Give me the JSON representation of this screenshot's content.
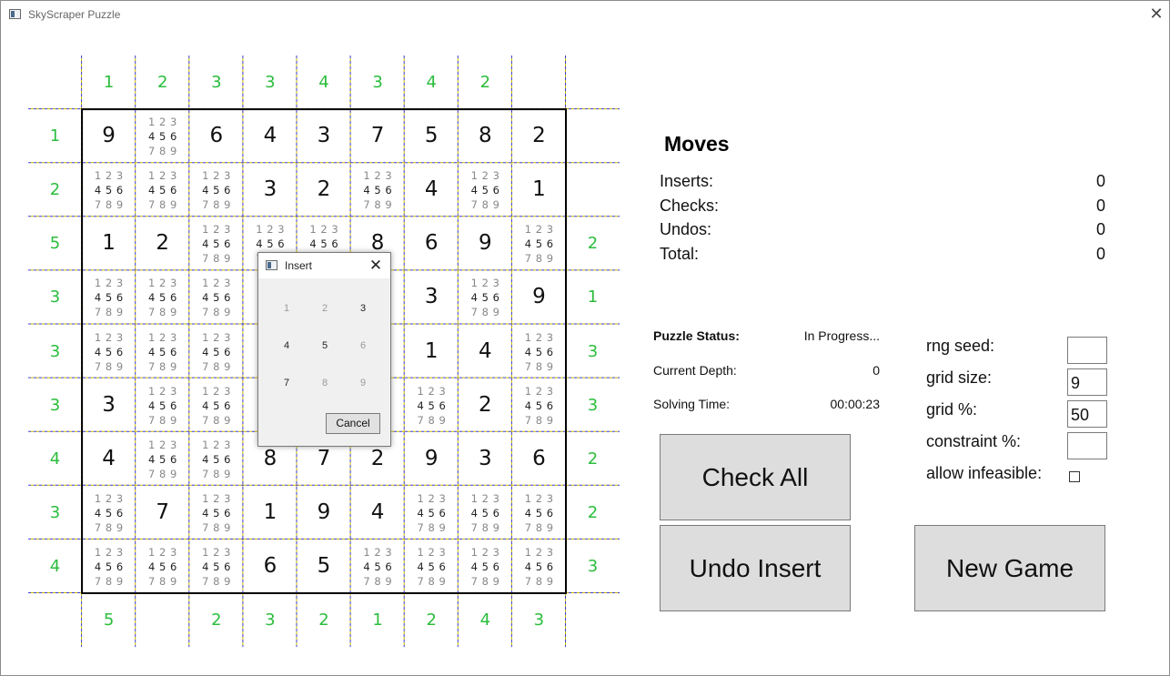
{
  "window": {
    "title": "SkyScraper Puzzle"
  },
  "puzzle": {
    "top_clues": [
      "1",
      "2",
      "3",
      "3",
      "4",
      "3",
      "4",
      "2",
      ""
    ],
    "bottom_clues": [
      "5",
      "",
      "2",
      "3",
      "2",
      "1",
      "2",
      "4",
      "3"
    ],
    "left_clues": [
      "1",
      "2",
      "5",
      "3",
      "3",
      "3",
      "4",
      "3",
      "4"
    ],
    "right_clues": [
      "",
      "",
      "2",
      "1",
      "3",
      "3",
      "2",
      "2",
      "3"
    ],
    "rows": [
      [
        "9",
        "N",
        "6",
        "4",
        "3",
        "7",
        "5",
        "8",
        "2"
      ],
      [
        "N",
        "N",
        "N",
        "3",
        "2",
        "N",
        "4",
        "N",
        "1"
      ],
      [
        "1",
        "2",
        "N",
        "N",
        "N",
        "8",
        "6",
        "9",
        "N"
      ],
      [
        "N",
        "N",
        "N",
        "",
        "",
        "",
        "3",
        "N",
        "9"
      ],
      [
        "N",
        "N",
        "N",
        "",
        "",
        "",
        "1",
        "4",
        "N"
      ],
      [
        "3",
        "N",
        "N",
        "",
        "",
        "",
        "N",
        "2",
        "N"
      ],
      [
        "4",
        "N",
        "N",
        "8",
        "7",
        "2",
        "9",
        "3",
        "6"
      ],
      [
        "N",
        "7",
        "N",
        "1",
        "9",
        "4",
        "N",
        "N",
        "N"
      ],
      [
        "N",
        "N",
        "N",
        "6",
        "5",
        "N",
        "N",
        "N",
        "N"
      ]
    ],
    "note_digits": [
      "1",
      "2",
      "3",
      "4",
      "5",
      "6",
      "7",
      "8",
      "9"
    ]
  },
  "insert_dialog": {
    "title": "Insert",
    "numbers": [
      "1",
      "2",
      "3",
      "4",
      "5",
      "6",
      "7",
      "8",
      "9"
    ],
    "enabled": [
      false,
      false,
      true,
      true,
      true,
      false,
      true,
      false,
      false
    ],
    "cancel_label": "Cancel"
  },
  "moves": {
    "title": "Moves",
    "stats": [
      {
        "label": "Inserts:",
        "value": "0"
      },
      {
        "label": "Checks:",
        "value": "0"
      },
      {
        "label": "Undos:",
        "value": "0"
      },
      {
        "label": "Total:",
        "value": "0"
      }
    ]
  },
  "status": {
    "puzzle_status_label": "Puzzle Status:",
    "puzzle_status_value": "In Progress...",
    "depth_label": "Current Depth:",
    "depth_value": "0",
    "time_label": "Solving Time:",
    "time_value": "00:00:23"
  },
  "config": {
    "rng_seed_label": "rng seed:",
    "rng_seed_value": "",
    "grid_size_label": "grid size:",
    "grid_size_value": "9",
    "grid_pct_label": "grid %:",
    "grid_pct_value": "50",
    "constraint_label": "constraint %:",
    "constraint_value": "",
    "infeasible_label": "allow infeasible:",
    "allow_infeasible": false
  },
  "buttons": {
    "check_all": "Check All",
    "undo_insert": "Undo Insert",
    "new_game": "New Game"
  },
  "colors": {
    "clue": "#2bbd3c",
    "dashed_line_a": "#3c3cc8",
    "dashed_line_b": "#c8b400",
    "note_muted": "#888888",
    "note_dark": "#222222"
  }
}
